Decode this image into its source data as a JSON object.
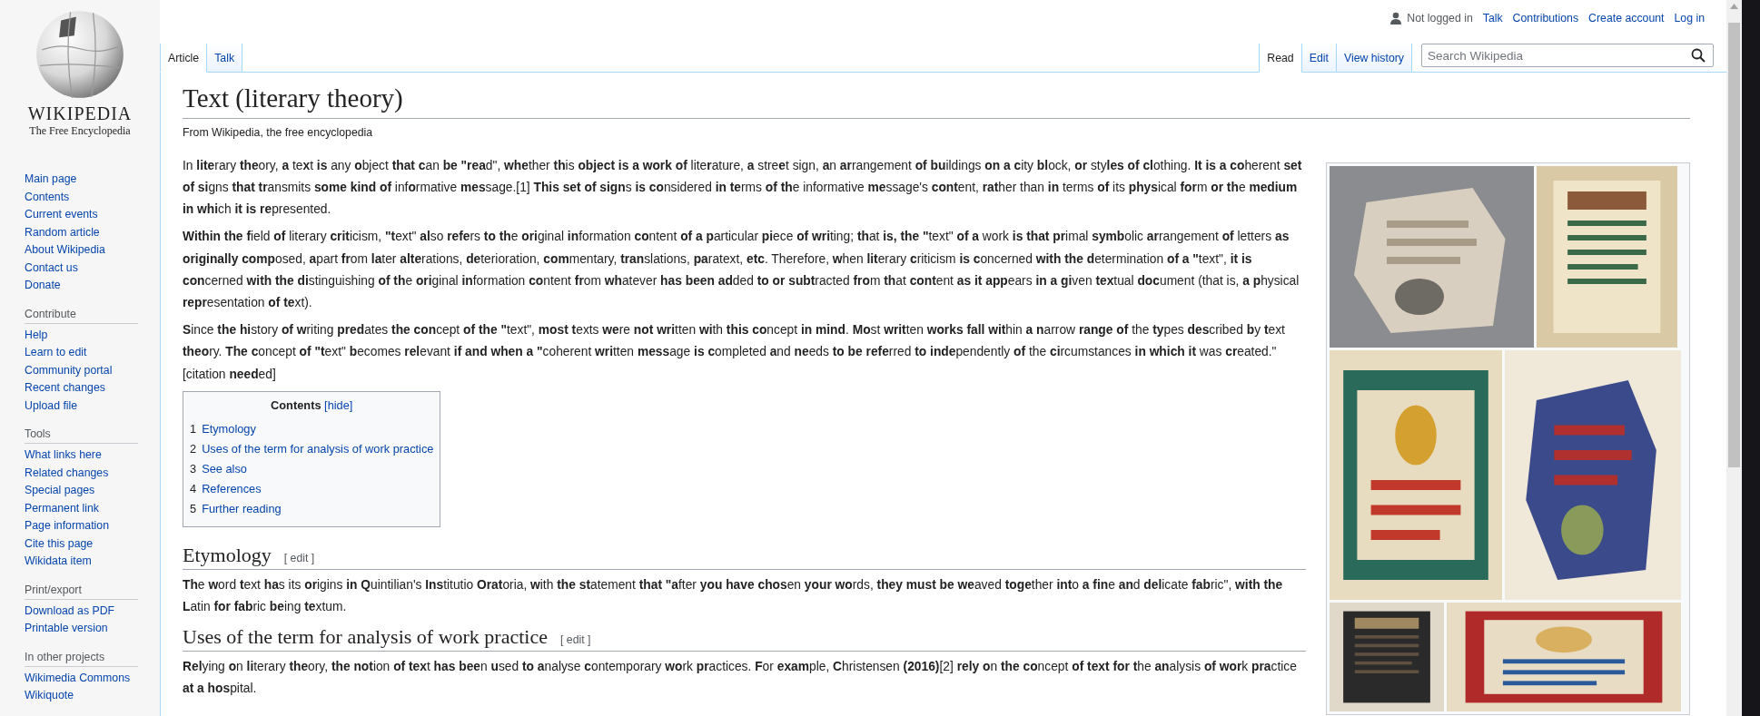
{
  "personal_tools": {
    "status": "Not logged in",
    "links": [
      "Talk",
      "Contributions",
      "Create account",
      "Log in"
    ]
  },
  "logo": {
    "wordmark": "WIKIPEDIA",
    "tagline": "The Free Encyclopedia"
  },
  "sidebar": {
    "main": [
      "Main page",
      "Contents",
      "Current events",
      "Random article",
      "About Wikipedia",
      "Contact us",
      "Donate"
    ],
    "sections": [
      {
        "heading": "Contribute",
        "items": [
          "Help",
          "Learn to edit",
          "Community portal",
          "Recent changes",
          "Upload file"
        ]
      },
      {
        "heading": "Tools",
        "items": [
          "What links here",
          "Related changes",
          "Special pages",
          "Permanent link",
          "Page information",
          "Cite this page",
          "Wikidata item"
        ]
      },
      {
        "heading": "Print/export",
        "items": [
          "Download as PDF",
          "Printable version"
        ]
      },
      {
        "heading": "In other projects",
        "items": [
          "Wikimedia Commons",
          "Wikiquote"
        ]
      }
    ]
  },
  "namespace_tabs": [
    {
      "label": "Article",
      "selected": true
    },
    {
      "label": "Talk",
      "selected": false
    }
  ],
  "view_tabs": [
    {
      "label": "Read",
      "selected": true
    },
    {
      "label": "Edit",
      "selected": false
    },
    {
      "label": "View history",
      "selected": false
    }
  ],
  "search": {
    "placeholder": "Search Wikipedia"
  },
  "article": {
    "title": "Text (literary theory)",
    "tagline": "From Wikipedia, the free encyclopedia",
    "intro": [
      "In **lite**rary **the**ory, **a** te**x**t **is** any **o**bject **that c**an **be \"rea**d\", **whe**ther **th**is **object is a work of** lite**r**ature, **a** stre**e**t sign, **a**n **ar**rangement **of bu**ildings **on a c**ity **bl**ock, **or** sty**les of cl**othing. **It is a co**herent **set of si**gns **that tr**ansmits **some kind of** inf**o**rmative **mes**sage.[1] **This set of sign**s **is co**nsidered **in te**rms **of th**e informative **me**ssage's **cont**ent, **rat**her than **in** terms **of** its **phys**ical **for**m **or th**e **medium in whi**ch **it is re**presented.",
      "**Within the f**ield **of** literary **crit**icism, **\"t**ext\" **al**so **refe**rs **to th**e **ori**ginal **in**formation **co**ntent **of a p**articular **pi**ece **of wri**ting; **th**at **is, the \"**text\" **of a** work **is that pr**imal **symb**olic **ar**rangement **of** letters **as originally comp**osed, **a**part **fr**om **la**ter **alte**rations, **de**terioration, **com**mentary, **tran**slations, **pa**ratext, **etc**. Therefore, **w**hen **lit**erary **c**riticism **is c**oncerned **with the d**etermination **of a \"**text\", **it is con**cerned **with the di**stinguishing **of th**e **ori**ginal **in**formation **co**ntent **fr**om **wh**atever **has been ad**ded **to or subt**racted **fro**m **th**at **cont**ent **as it app**ears **in a gi**ven **tex**tual **doc**ument (that is, **a p**hysical **repr**esentation **of te**xt).",
      "**S**ince **the hi**story **of w**riting **pred**ates **the con**cept **of the \"**text\", **most t**exts **we**re **not wri**tten **wi**th **this co**ncept **in mind**. **Mo**st **writ**ten **works fall wit**hin **a n**arrow **range of** the **ty**pes **des**cribed **b**y **t**ext **theo**ry. **The c**oncept **of \"t**ext\" **b**ecomes **rel**evant **if and when a \"**coherent **wri**tten **mess**age **is c**ompleted **a**nd **ne**eds **to be refe**rred **to inde**pendently **of** the **ci**rcumstances **in which it** was **cr**eated.\" [citation **need**ed]"
    ],
    "toc": {
      "title": "Contents",
      "toggle": "[hide]",
      "items": [
        {
          "number": "1",
          "label": "Etymology"
        },
        {
          "number": "2",
          "label": "Uses of the term for analysis of work practice"
        },
        {
          "number": "3",
          "label": "See also"
        },
        {
          "number": "4",
          "label": "References"
        },
        {
          "number": "5",
          "label": "Further reading"
        }
      ]
    },
    "sections": [
      {
        "heading": "Etymology",
        "edit": "[ edit ]",
        "paragraphs": [
          "**Th**e **w**ord **t**ext **ha**s its **or**igins **in Q**uintilian's **Ins**titutio **Orat**oria, **w**ith **the st**atement **that \"a**fter **you have chos**en **your wo**rds, **they must be we**aved **toge**ther **int**o **a fin**e **an**d **del**icate **fab**ric\", **with the L**atin **for fab**ric **be**ing **te**xtum."
        ]
      },
      {
        "heading": "Uses of the term for analysis of work practice",
        "edit": "[ edit ]",
        "paragraphs": [
          "**Rel**ying **o**n **li**terary **the**ory, **the not**ion **of tex**t **has bee**n **u**sed **to a**nalyse **c**ontemporary **wo**rk **pr**actices. **F**or **exam**ple, **C**hristensen **(2016)**[2] **rely o**n **the co**ncept **of text for t**he **an**alysis **of wor**k **pra**ctice **at a hos**pital."
        ]
      }
    ]
  }
}
